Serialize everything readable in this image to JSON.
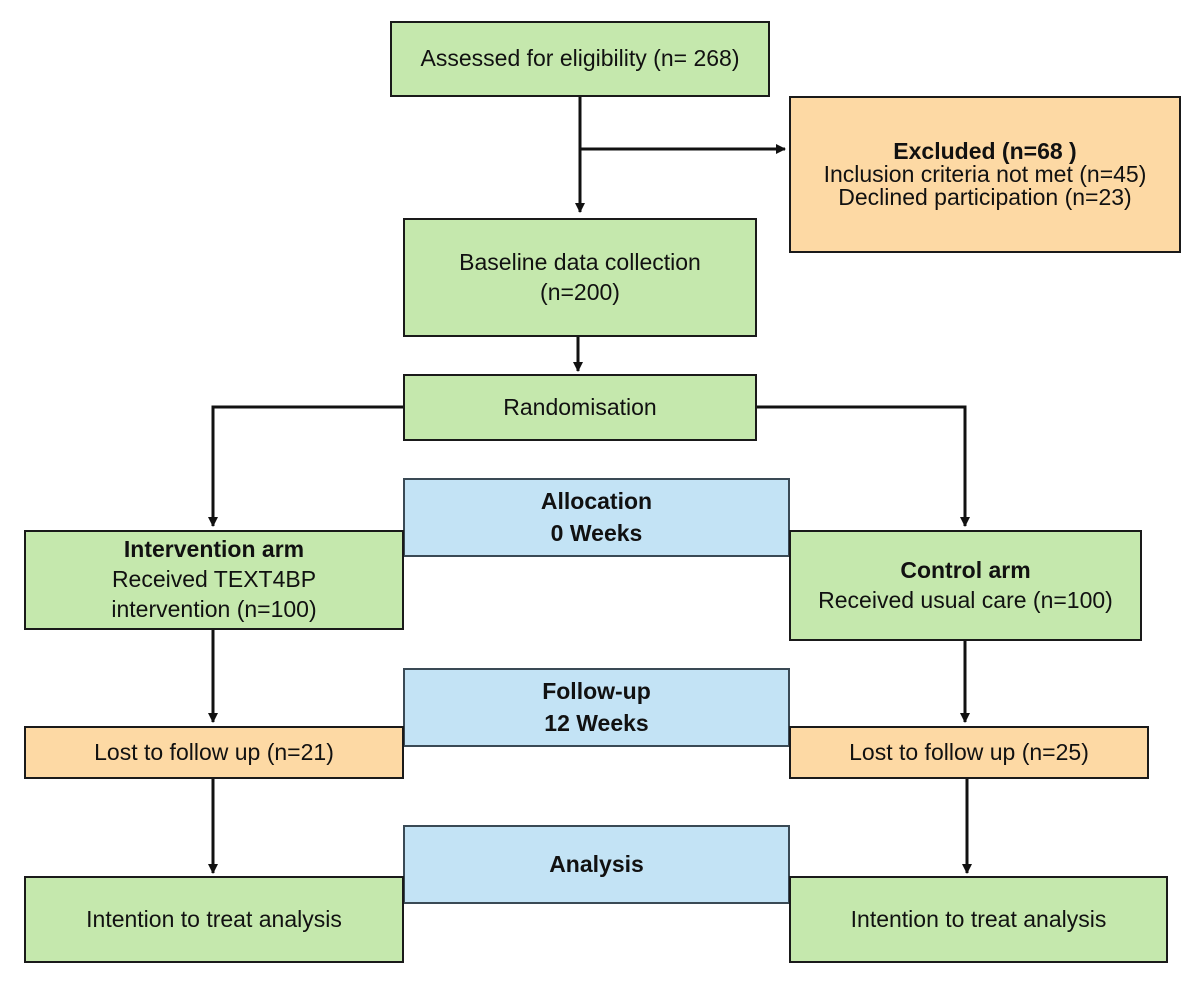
{
  "colors": {
    "step_fill": "#c5e8ad",
    "exclusion_fill": "#fdd9a4",
    "phase_fill": "#c3e3f5",
    "line": "#111111"
  },
  "nodes": {
    "assessed": {
      "lines": [
        "Assessed for eligibility (n= 268)"
      ]
    },
    "excluded": {
      "title": "Excluded (n=68 )",
      "lines": [
        "Inclusion criteria not met (n=45)",
        "Declined participation (n=23)"
      ]
    },
    "baseline": {
      "lines": [
        "Baseline data collection",
        "(n=200)"
      ]
    },
    "randomisation": {
      "lines": [
        "Randomisation"
      ]
    },
    "intervention_arm": {
      "title": "Intervention arm",
      "lines": [
        "Received TEXT4BP",
        "intervention (n=100)"
      ]
    },
    "control_arm": {
      "title": "Control arm",
      "lines": [
        "Received usual care (n=100)"
      ]
    },
    "lost_intervention": {
      "lines": [
        "Lost to follow up (n=21)"
      ]
    },
    "lost_control": {
      "lines": [
        "Lost to follow up (n=25)"
      ]
    },
    "itt_intervention": {
      "lines": [
        "Intention to treat analysis"
      ]
    },
    "itt_control": {
      "lines": [
        "Intention to treat analysis"
      ]
    }
  },
  "phases": {
    "allocation": {
      "lines": [
        "Allocation",
        "0 Weeks"
      ]
    },
    "follow_up": {
      "lines": [
        "Follow-up",
        "12 Weeks"
      ]
    },
    "analysis": {
      "lines": [
        "Analysis"
      ]
    }
  }
}
